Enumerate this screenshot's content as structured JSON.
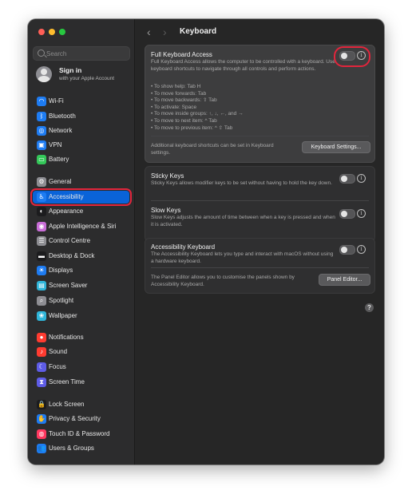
{
  "search": {
    "placeholder": "Search"
  },
  "account": {
    "title": "Sign in",
    "subtitle": "with your Apple Account"
  },
  "sidebar": {
    "items": [
      {
        "label": "Wi-Fi",
        "icon": "wifi-icon",
        "color": "#1e7cf2",
        "glyph": "◠"
      },
      {
        "label": "Bluetooth",
        "icon": "bluetooth-icon",
        "color": "#1e7cf2",
        "glyph": "ᛒ"
      },
      {
        "label": "Network",
        "icon": "globe-icon",
        "color": "#1e7cf2",
        "glyph": "◎"
      },
      {
        "label": "VPN",
        "icon": "vpn-icon",
        "color": "#1e7cf2",
        "glyph": "▣"
      },
      {
        "label": "Battery",
        "icon": "battery-icon",
        "color": "#34c759",
        "glyph": "▭"
      },
      {
        "label": "General",
        "icon": "gear-icon",
        "color": "#8e8e93",
        "glyph": "⚙"
      },
      {
        "label": "Accessibility",
        "icon": "accessibility-icon",
        "color": "#1e7cf2",
        "glyph": "♿"
      },
      {
        "label": "Appearance",
        "icon": "appearance-icon",
        "color": "#1c1c1e",
        "glyph": "◐"
      },
      {
        "label": "Apple Intelligence & Siri",
        "icon": "siri-icon",
        "color": "#c86dd7",
        "glyph": "◉"
      },
      {
        "label": "Control Centre",
        "icon": "control-centre-icon",
        "color": "#8e8e93",
        "glyph": "☰"
      },
      {
        "label": "Desktop & Dock",
        "icon": "dock-icon",
        "color": "#1c1c1e",
        "glyph": "▬"
      },
      {
        "label": "Displays",
        "icon": "displays-icon",
        "color": "#1e7cf2",
        "glyph": "☀"
      },
      {
        "label": "Screen Saver",
        "icon": "screen-saver-icon",
        "color": "#2fb5d9",
        "glyph": "▤"
      },
      {
        "label": "Spotlight",
        "icon": "spotlight-icon",
        "color": "#8e8e93",
        "glyph": "⌕"
      },
      {
        "label": "Wallpaper",
        "icon": "wallpaper-icon",
        "color": "#2fb5d9",
        "glyph": "❀"
      },
      {
        "label": "Notifications",
        "icon": "notifications-icon",
        "color": "#ff3b30",
        "glyph": "●"
      },
      {
        "label": "Sound",
        "icon": "sound-icon",
        "color": "#ff3b30",
        "glyph": "♪"
      },
      {
        "label": "Focus",
        "icon": "focus-icon",
        "color": "#5e5ce6",
        "glyph": "☾"
      },
      {
        "label": "Screen Time",
        "icon": "screen-time-icon",
        "color": "#5e5ce6",
        "glyph": "⧗"
      },
      {
        "label": "Lock Screen",
        "icon": "lock-icon",
        "color": "#1c1c1e",
        "glyph": "🔒"
      },
      {
        "label": "Privacy & Security",
        "icon": "privacy-icon",
        "color": "#1e7cf2",
        "glyph": "✋"
      },
      {
        "label": "Touch ID & Password",
        "icon": "fingerprint-icon",
        "color": "#ff375f",
        "glyph": "◍"
      },
      {
        "label": "Users & Groups",
        "icon": "users-icon",
        "color": "#1e7cf2",
        "glyph": "👥"
      }
    ],
    "selected": "Accessibility"
  },
  "main": {
    "title": "Keyboard",
    "full_keyboard_access": {
      "title": "Full Keyboard Access",
      "description": "Full Keyboard Access allows the computer to be controlled with a keyboard. Use keyboard shortcuts to navigate through all controls and perform actions.",
      "shortcuts": [
        "• To show help: Tab H",
        "• To move forwards: Tab",
        "• To move backwards: ⇧ Tab",
        "• To activate: Space",
        "• To move inside groups: ↑, ↓, ←, and →",
        "• To move to next item: ^ Tab",
        "• To move to previous item: ^ ⇧ Tab"
      ],
      "footer": "Additional keyboard shortcuts can be set in Keyboard settings.",
      "button": "Keyboard Settings...",
      "enabled": false
    },
    "sticky_keys": {
      "title": "Sticky Keys",
      "description": "Sticky Keys allows modifier keys to be set without having to hold the key down.",
      "enabled": false
    },
    "slow_keys": {
      "title": "Slow Keys",
      "description": "Slow Keys adjusts the amount of time between when a key is pressed and when it is activated.",
      "enabled": false
    },
    "accessibility_keyboard": {
      "title": "Accessibility Keyboard",
      "description": "The Accessibility Keyboard lets you type and interact with macOS without using a hardware keyboard.",
      "footer": "The Panel Editor allows you to customise the panels shown by Accessibility Keyboard.",
      "button": "Panel Editor...",
      "enabled": false
    },
    "help": "?"
  },
  "colors": {
    "accent": "#0a63d8",
    "annotation": "#e2253c"
  }
}
